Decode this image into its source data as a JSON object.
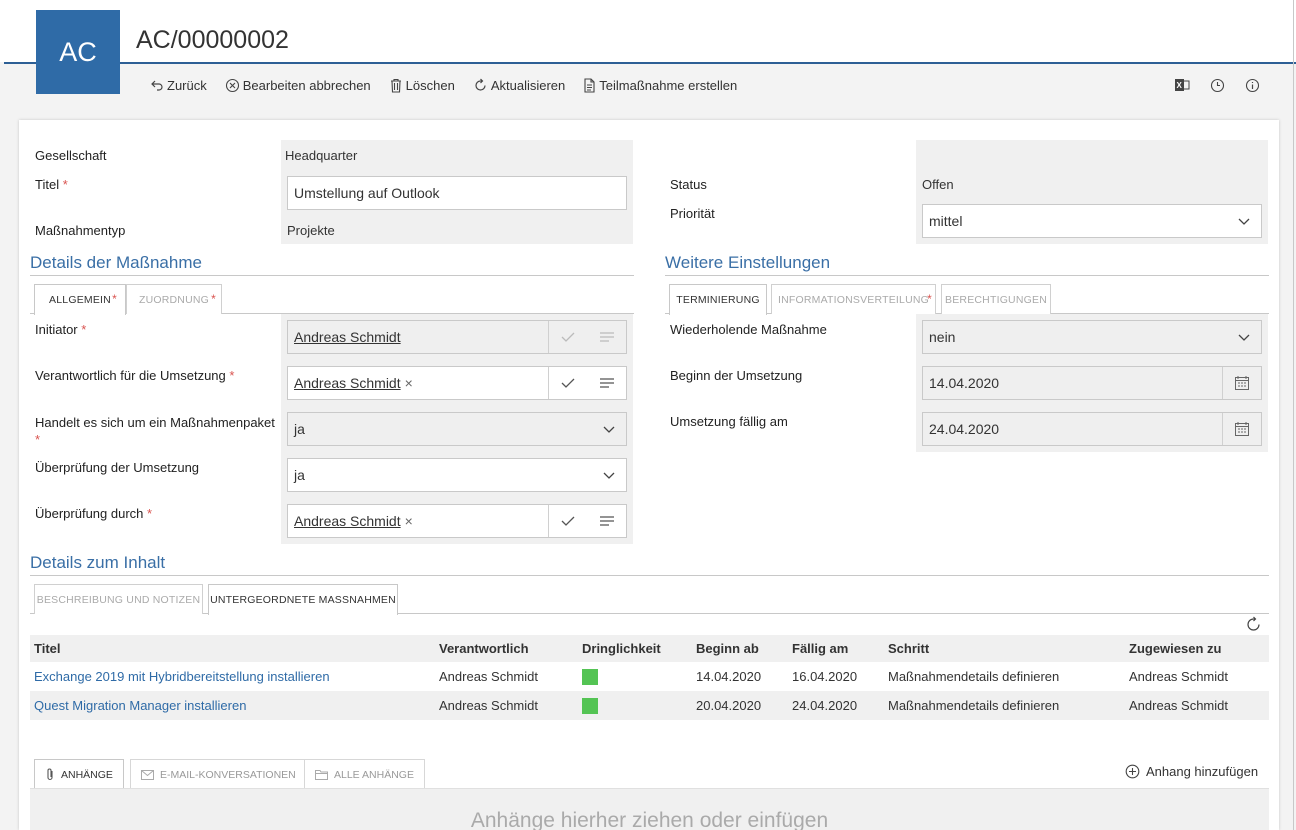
{
  "header": {
    "avatar_initials": "AC",
    "record_id": "AC/00000002",
    "toolbar": {
      "back": "Zurück",
      "cancel_edit": "Bearbeiten abbrechen",
      "delete": "Löschen",
      "refresh": "Aktualisieren",
      "create_sub": "Teilmaßnahme erstellen"
    },
    "right_icons": [
      "excel-icon",
      "history-icon",
      "info-icon"
    ]
  },
  "general": {
    "company_label": "Gesellschaft",
    "company_value": "Headquarter",
    "title_label": "Titel",
    "title_value": "Umstellung auf Outlook",
    "type_label": "Maßnahmentyp",
    "type_value": "Projekte",
    "status_label": "Status",
    "status_value": "Offen",
    "priority_label": "Priorität",
    "priority_value": "mittel",
    "required_mark": "*"
  },
  "details": {
    "title": "Details der Maßnahme",
    "tabs": [
      "ALLGEMEIN",
      "ZUORDNUNG"
    ],
    "initiator_label": "Initiator",
    "initiator_value": "Andreas Schmidt",
    "responsible_label": "Verantwortlich für die Umsetzung",
    "responsible_value": "Andreas Schmidt",
    "package_label": "Handelt es sich um ein Maßnahmenpaket",
    "package_value": "ja",
    "review_label": "Überprüfung der Umsetzung",
    "review_value": "ja",
    "reviewer_label": "Überprüfung durch",
    "reviewer_value": "Andreas Schmidt",
    "remove_mark": "×"
  },
  "settings": {
    "title": "Weitere Einstellungen",
    "tabs": [
      "TERMINIERUNG",
      "INFORMATIONSVERTEILUNG",
      "BERECHTIGUNGEN"
    ],
    "recurring_label": "Wiederholende Maßnahme",
    "recurring_value": "nein",
    "start_label": "Beginn der Umsetzung",
    "start_value": "14.04.2020",
    "due_label": "Umsetzung fällig am",
    "due_value": "24.04.2020"
  },
  "content": {
    "title": "Details zum Inhalt",
    "tabs": [
      "BESCHREIBUNG UND NOTIZEN",
      "UNTERGEORDNETE MASSNAHMEN"
    ],
    "columns": [
      "Titel",
      "Verantwortlich",
      "Dringlichkeit",
      "Beginn ab",
      "Fällig am",
      "Schritt",
      "Zugewiesen zu"
    ],
    "rows": [
      {
        "title": "Exchange 2019 mit Hybridbereitstellung installieren",
        "responsible": "Andreas Schmidt",
        "urgency_color": "#54c454",
        "start": "14.04.2020",
        "due": "16.04.2020",
        "step": "Maßnahmendetails definieren",
        "assigned": "Andreas Schmidt"
      },
      {
        "title": "Quest Migration Manager installieren",
        "responsible": "Andreas Schmidt",
        "urgency_color": "#54c454",
        "start": "20.04.2020",
        "due": "24.04.2020",
        "step": "Maßnahmendetails definieren",
        "assigned": "Andreas Schmidt"
      }
    ]
  },
  "attachments": {
    "tabs": [
      "ANHÄNGE",
      "E-MAIL-KONVERSATIONEN",
      "ALLE ANHÄNGE"
    ],
    "add_label": "Anhang hinzufügen",
    "dropzone_text": "Anhänge hierher ziehen oder einfügen"
  }
}
